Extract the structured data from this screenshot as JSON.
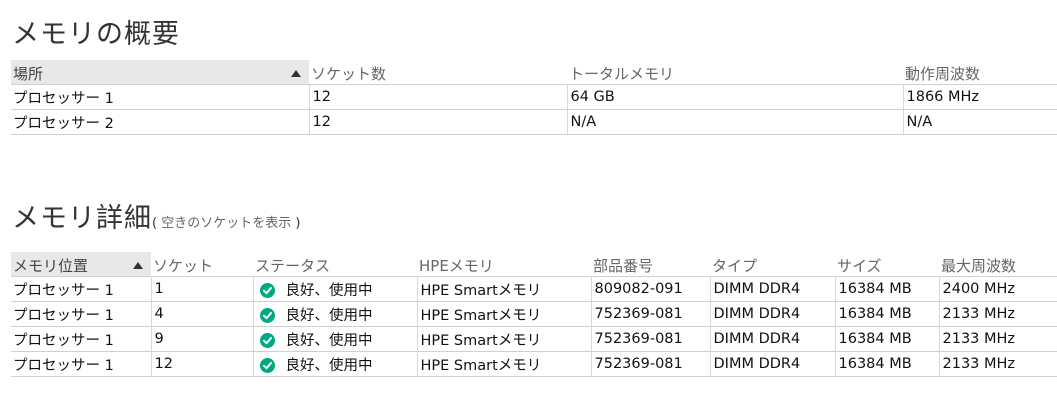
{
  "summary": {
    "title": "メモリの概要",
    "columns": [
      "場所",
      "ソケット数",
      "トータルメモリ",
      "動作周波数"
    ],
    "rows": [
      [
        "プロセッサー 1",
        "12",
        "64 GB",
        "1866 MHz"
      ],
      [
        "プロセッサー 2",
        "12",
        "N/A",
        "N/A"
      ]
    ]
  },
  "details": {
    "title": "メモリ詳細",
    "show_empty_open": "(",
    "show_empty_label": " 空きのソケットを表示 ",
    "show_empty_close": ")",
    "columns": [
      "メモリ位置",
      "ソケット",
      "ステータス",
      "HPEメモリ",
      "部品番号",
      "タイプ",
      "サイズ",
      "最大周波数"
    ],
    "rows": [
      [
        "プロセッサー 1",
        "1",
        "良好、使用中",
        "HPE Smartメモリ",
        "809082-091",
        "DIMM DDR4",
        "16384 MB",
        "2400 MHz"
      ],
      [
        "プロセッサー 1",
        "4",
        "良好、使用中",
        "HPE Smartメモリ",
        "752369-081",
        "DIMM DDR4",
        "16384 MB",
        "2133 MHz"
      ],
      [
        "プロセッサー 1",
        "9",
        "良好、使用中",
        "HPE Smartメモリ",
        "752369-081",
        "DIMM DDR4",
        "16384 MB",
        "2133 MHz"
      ],
      [
        "プロセッサー 1",
        "12",
        "良好、使用中",
        "HPE Smartメモリ",
        "752369-081",
        "DIMM DDR4",
        "16384 MB",
        "2133 MHz"
      ]
    ]
  },
  "status_icon": "check-circle-icon",
  "colors": {
    "status_ok": "#01a982",
    "sorted_header_bg": "#e8e8e8"
  }
}
